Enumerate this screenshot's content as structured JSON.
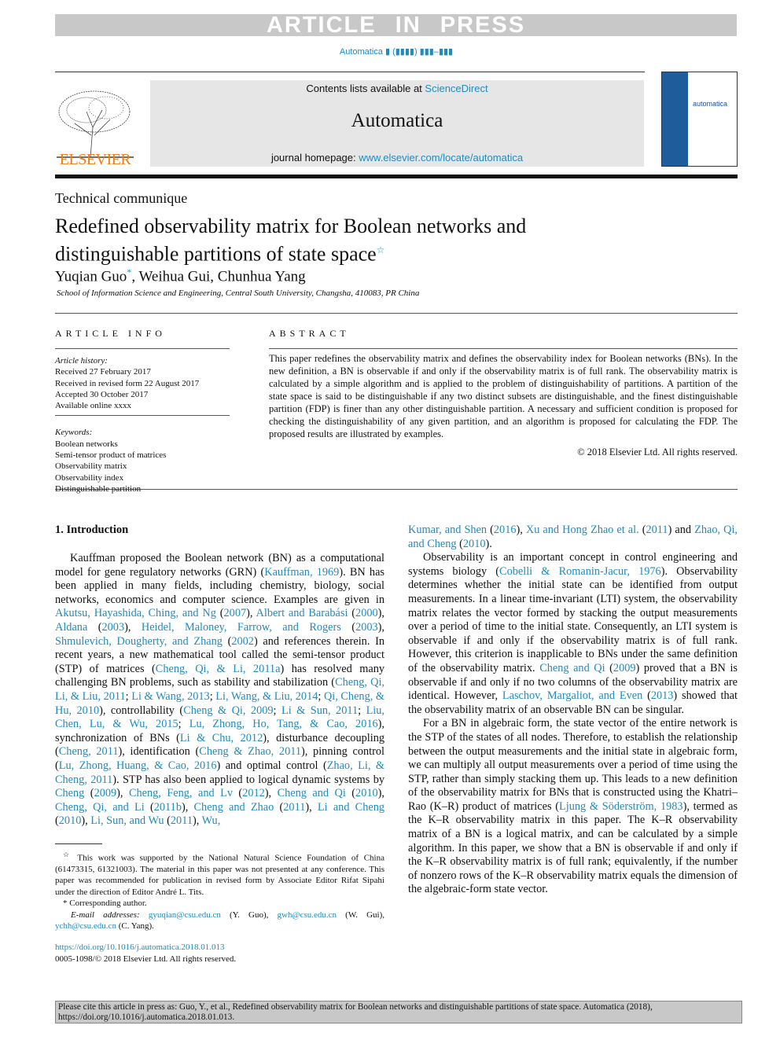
{
  "header": {
    "banner": "ARTICLE IN PRESS",
    "journal_ref": "Automatica ▮ (▮▮▮▮) ▮▮▮–▮▮▮",
    "contents_prefix": "Contents lists available at ",
    "sciencedirect": "ScienceDirect",
    "journal_title": "Automatica",
    "homepage_prefix": "journal homepage: ",
    "homepage_url": "www.elsevier.com/locate/automatica",
    "publisher_logo": "ELSEVIER",
    "cover_title": "automatica"
  },
  "article": {
    "type": "Technical communique",
    "title_line1": "Redefined observability matrix for Boolean networks and",
    "title_line2": "distinguishable partitions of state space",
    "title_mark": "☆",
    "authors_first": "Yuqian Guo",
    "author_mark": "*",
    "authors_rest": ", Weihua Gui, Chunhua Yang",
    "affiliation": "School of Information Science and Engineering, Central South University, Changsha, 410083, PR China"
  },
  "article_info": {
    "heading": "ARTICLE INFO",
    "history_label": "Article history:",
    "history": [
      "Received 27 February 2017",
      "Received in revised form 22 August 2017",
      "Accepted 30 October 2017",
      "Available online xxxx"
    ],
    "keywords_label": "Keywords:",
    "keywords": [
      "Boolean networks",
      "Semi-tensor product of matrices",
      "Observability matrix",
      "Observability index",
      "Distinguishable partition"
    ]
  },
  "abstract": {
    "heading": "ABSTRACT",
    "text": "This paper redefines the observability matrix and defines the observability index for Boolean networks (BNs). In the new definition, a BN is observable if and only if the observability matrix is of full rank. The observability matrix is calculated by a simple algorithm and is applied to the problem of distinguishability of partitions. A partition of the state space is said to be distinguishable if any two distinct subsets are distinguishable, and the finest distinguishable partition (FDP) is finer than any other distinguishable partition. A necessary and sufficient condition is proposed for checking the distinguishability of any given partition, and an algorithm is proposed for calculating the FDP. The proposed results are illustrated by examples.",
    "copyright": "© 2018 Elsevier Ltd. All rights reserved."
  },
  "intro": {
    "heading": "1.  Introduction",
    "col1": [
      [
        [
          "Kauffman proposed the Boolean network (BN) as a computational model for gene regulatory networks (GRN) ("
        ],
        [
          "Kauffman, 1969",
          1
        ],
        [
          "). BN has been applied in many fields, including chemistry, biology, social networks, economics and computer science. Examples are given in "
        ],
        [
          "Akutsu, Hayashida, Ching, and Ng",
          1
        ],
        [
          " ("
        ],
        [
          "2007",
          1
        ],
        [
          "), "
        ],
        [
          "Albert and Barabási",
          1
        ],
        [
          " ("
        ],
        [
          "2000",
          1
        ],
        [
          "), "
        ],
        [
          "Aldana",
          1
        ],
        [
          " ("
        ],
        [
          "2003",
          1
        ],
        [
          "), "
        ],
        [
          "Heidel, Maloney, Farrow, and Rogers",
          1
        ],
        [
          " ("
        ],
        [
          "2003",
          1
        ],
        [
          "), "
        ],
        [
          "Shmulevich, Dougherty, and Zhang",
          1
        ],
        [
          " ("
        ],
        [
          "2002",
          1
        ],
        [
          ") and references therein. In recent years, a new mathematical tool called the semi-tensor product (STP) of matrices ("
        ],
        [
          "Cheng, Qi, & Li, 2011a",
          1
        ],
        [
          ") has resolved many challenging BN problems, such as stability and stabilization ("
        ],
        [
          "Cheng, Qi, Li, & Liu, 2011",
          1
        ],
        [
          "; "
        ],
        [
          "Li & Wang, 2013",
          1
        ],
        [
          "; "
        ],
        [
          "Li, Wang, & Liu, 2014",
          1
        ],
        [
          "; "
        ],
        [
          "Qi, Cheng, & Hu, 2010",
          1
        ],
        [
          "), controllability ("
        ],
        [
          "Cheng & Qi, 2009",
          1
        ],
        [
          "; "
        ],
        [
          "Li & Sun, 2011",
          1
        ],
        [
          "; "
        ],
        [
          "Liu, Chen, Lu, & Wu, 2015",
          1
        ],
        [
          "; "
        ],
        [
          "Lu, Zhong, Ho, Tang, & Cao, 2016",
          1
        ],
        [
          "), synchronization of BNs ("
        ],
        [
          "Li & Chu, 2012",
          1
        ],
        [
          "), disturbance decoupling ("
        ],
        [
          "Cheng, 2011",
          1
        ],
        [
          "), identification ("
        ],
        [
          "Cheng & Zhao, 2011",
          1
        ],
        [
          "), pinning control ("
        ],
        [
          "Lu, Zhong, Huang, & Cao, 2016",
          1
        ],
        [
          ") and optimal control ("
        ],
        [
          "Zhao, Li, & Cheng, 2011",
          1
        ],
        [
          "). STP has also been applied to logical dynamic systems by "
        ],
        [
          "Cheng",
          1
        ],
        [
          " ("
        ],
        [
          "2009",
          1
        ],
        [
          "), "
        ],
        [
          "Cheng, Feng, and Lv",
          1
        ],
        [
          " ("
        ],
        [
          "2012",
          1
        ],
        [
          "), "
        ],
        [
          "Cheng and Qi",
          1
        ],
        [
          " ("
        ],
        [
          "2010",
          1
        ],
        [
          "), "
        ],
        [
          "Cheng, Qi, and Li",
          1
        ],
        [
          " ("
        ],
        [
          "2011b",
          1
        ],
        [
          "), "
        ],
        [
          "Cheng and Zhao",
          1
        ],
        [
          " ("
        ],
        [
          "2011",
          1
        ],
        [
          "), "
        ],
        [
          "Li and Cheng",
          1
        ],
        [
          " ("
        ],
        [
          "2010",
          1
        ],
        [
          "), "
        ],
        [
          "Li, Sun, and Wu",
          1
        ],
        [
          " ("
        ],
        [
          "2011",
          1
        ],
        [
          "), "
        ],
        [
          "Wu,",
          1
        ]
      ]
    ],
    "col2": [
      [
        [
          "Kumar, and Shen",
          1
        ],
        [
          " ("
        ],
        [
          "2016",
          1
        ],
        [
          "), "
        ],
        [
          "Xu and Hong Zhao et al.",
          1
        ],
        [
          " ("
        ],
        [
          "2011",
          1
        ],
        [
          ") and "
        ],
        [
          "Zhao, Qi, and Cheng",
          1
        ],
        [
          " ("
        ],
        [
          "2010",
          1
        ],
        [
          ")."
        ]
      ],
      [
        [
          "Observability is an important concept in control engineering and systems biology ("
        ],
        [
          "Cobelli & Romanin-Jacur, 1976",
          1
        ],
        [
          "). Observability determines whether the initial state can be identified from output measurements. In a linear time-invariant (LTI) system, the observability matrix relates the vector formed by stacking the output measurements over a period of time to the initial state. Consequently, an LTI system is observable if and only if the observability matrix is of full rank. However, this criterion is inapplicable to BNs under the same definition of the observability matrix. "
        ],
        [
          "Cheng and Qi",
          1
        ],
        [
          " ("
        ],
        [
          "2009",
          1
        ],
        [
          ") proved that a BN is observable if and only if no two columns of the observability matrix are identical. However, "
        ],
        [
          "Laschov, Margaliot, and Even",
          1
        ],
        [
          " ("
        ],
        [
          "2013",
          1
        ],
        [
          ") showed that the observability matrix of an observable BN can be singular."
        ]
      ],
      [
        [
          "For a BN in algebraic form, the state vector of the entire network is the STP of the states of all nodes. Therefore, to establish the relationship between the output measurements and the initial state in algebraic form, we can multiply all output measurements over a period of time using the STP, rather than simply stacking them up. This leads to a new definition of the observability matrix for BNs that is constructed using the Khatri–Rao (K–R) product of matrices ("
        ],
        [
          "Ljung & Söderström, 1983",
          1
        ],
        [
          "), termed as the K–R observability matrix in this paper. The K–R observability matrix of a BN is a logical matrix, and can be calculated by a simple algorithm. In this paper, we show that a BN is observable if and only if the K–R observability matrix is of full rank; equivalently, if the number of nonzero rows of the K–R observability matrix equals the dimension of the algebraic-form state vector."
        ]
      ]
    ]
  },
  "footnotes": {
    "star_mark": "☆",
    "funding": " This work was supported by the National Natural Science Foundation of China (61473315, 61321003). The material in this paper was not presented at any conference. This paper was recommended for publication in revised form by Associate Editor Rifat Sipahi under the direction of Editor André L. Tits.",
    "corr_mark": "*",
    "corresponding": " Corresponding author.",
    "email_label": "E-mail addresses: ",
    "email1": "gyuqian@csu.edu.cn",
    "name1": " (Y. Guo), ",
    "email2": "gwh@csu.edu.cn",
    "name2": " (W. Gui),",
    "email3": "ychh@csu.edu.cn",
    "name3": " (C. Yang)."
  },
  "doi": {
    "url": "https://doi.org/10.1016/j.automatica.2018.01.013",
    "issn": "0005-1098/© 2018 Elsevier Ltd. All rights reserved."
  },
  "citation_box": "Please cite this article in press as: Guo, Y., et al., Redefined observability matrix for Boolean networks and distinguishable partitions of state space. Automatica (2018), https://doi.org/10.1016/j.automatica.2018.01.013.",
  "colors": {
    "link": "#1f8bbf",
    "banner_gray": "#c8c8c8",
    "elsevier_orange": "#f07c16",
    "cover_blue": "#1f5c9c"
  }
}
